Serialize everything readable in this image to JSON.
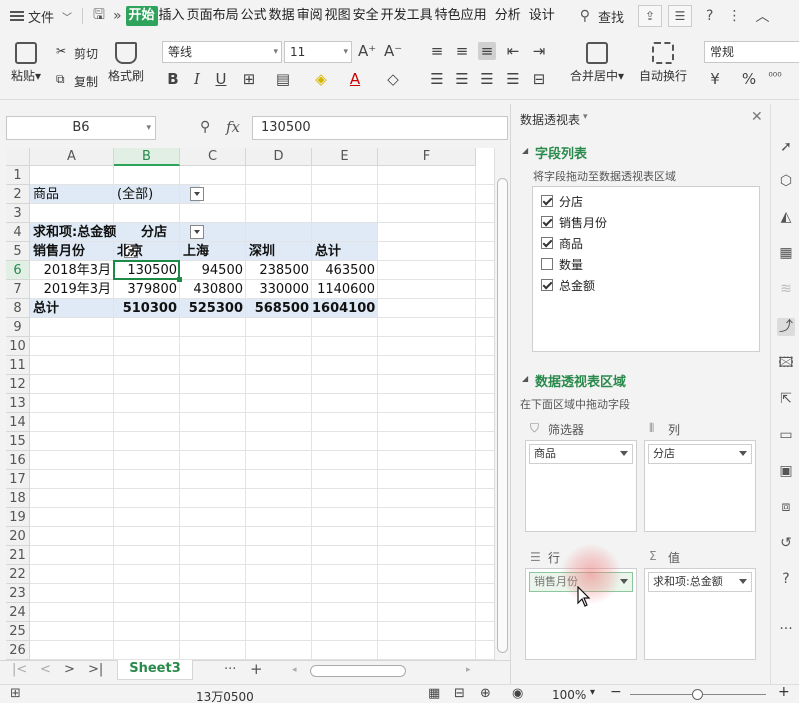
{
  "menubar": {
    "file_label": "文件",
    "tabs": [
      "开始",
      "插入",
      "页面布局",
      "公式",
      "数据",
      "审阅",
      "视图",
      "安全",
      "开发工具",
      "特色应用",
      "分析",
      "设计"
    ],
    "search_label": "查找"
  },
  "ribbon": {
    "paste": "粘贴",
    "cut": "剪切",
    "copy": "复制",
    "format_painter": "格式刷",
    "font_name": "等线",
    "font_size": "11",
    "merge_center": "合并居中",
    "wrap_text": "自动换行",
    "number_format": "常规"
  },
  "formula_bar": {
    "name_box": "B6",
    "fx": "fx",
    "value": "130500"
  },
  "grid": {
    "columns": [
      "A",
      "B",
      "C",
      "D",
      "E",
      "F"
    ],
    "rows": [
      "1",
      "2",
      "3",
      "4",
      "5",
      "6",
      "7",
      "8",
      "9",
      "10",
      "11",
      "12",
      "13",
      "14",
      "15",
      "16",
      "17",
      "18",
      "19",
      "20",
      "21",
      "22",
      "23",
      "24",
      "25",
      "26"
    ],
    "filter_label": "商品",
    "filter_value": "(全部)",
    "sum_label": "求和项:总金额",
    "col_field": "分店",
    "row_field": "销售月份",
    "headers": [
      "北京",
      "上海",
      "深圳",
      "总计"
    ],
    "data_rows": [
      {
        "label": "2018年3月",
        "values": [
          "130500",
          "94500",
          "238500",
          "463500"
        ]
      },
      {
        "label": "2019年3月",
        "values": [
          "379800",
          "430800",
          "330000",
          "1140600"
        ]
      }
    ],
    "total": {
      "label": "总计",
      "values": [
        "510300",
        "525300",
        "568500",
        "1604100"
      ]
    }
  },
  "sheetbar": {
    "sheet_name": "Sheet3",
    "more": "···",
    "add": "+"
  },
  "statusbar": {
    "sum_text": "13万0500",
    "zoom": "100%"
  },
  "pivot_pane": {
    "title": "数据透视表",
    "field_list_title": "字段列表",
    "field_list_hint": "将字段拖动至数据透视表区域",
    "fields": [
      {
        "name": "分店",
        "checked": true
      },
      {
        "name": "销售月份",
        "checked": true
      },
      {
        "name": "商品",
        "checked": true
      },
      {
        "name": "数量",
        "checked": false
      },
      {
        "name": "总金额",
        "checked": true
      }
    ],
    "areas_title": "数据透视表区域",
    "areas_hint": "在下面区域中拖动字段",
    "filter_area": {
      "label": "筛选器",
      "field": "商品"
    },
    "column_area": {
      "label": "列",
      "field": "分店"
    },
    "row_area": {
      "label": "行",
      "field": "销售月份"
    },
    "value_area": {
      "label": "值",
      "field": "求和项:总金额"
    }
  }
}
